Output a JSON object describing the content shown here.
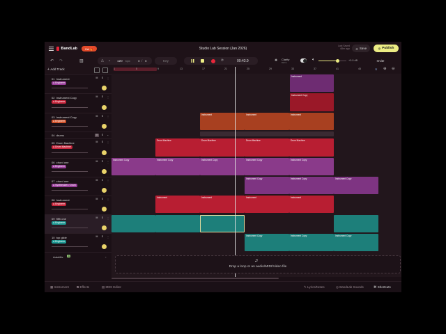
{
  "app": {
    "logo": "BandLab",
    "badge": "Get 🎁",
    "title": "Studio Lab Session (Jan 2026)",
    "last_saved": "Last Saved",
    "last_saved_time": "48m ago",
    "save": "Save",
    "publish": "Publish",
    "invite": "Invite"
  },
  "transport": {
    "tempo": "120",
    "tempo_unit": "bpm",
    "sig_num": "4",
    "sig_den": "4",
    "key": "Key",
    "time": "00:43.9",
    "clarity": "Clarity",
    "clarity_sub": "BETA",
    "volume_db": "+0.0 dB"
  },
  "tracks_header": {
    "add": "Add Track"
  },
  "ruler": [
    "1",
    "5",
    "9",
    "13",
    "17",
    "21",
    "25",
    "29",
    "33",
    "37",
    "41",
    "45"
  ],
  "tracks": [
    {
      "num": "01",
      "name": "Instrument",
      "badge": "● Engineer",
      "badge_color": "#9b3f9c",
      "knob": true
    },
    {
      "num": "02",
      "name": "Instrument Copy",
      "badge": "● Engineer",
      "badge_color": "#c8263c",
      "knob": true
    },
    {
      "num": "03",
      "name": "Instrument Copy",
      "badge": "● Engineer",
      "badge_color": "#d2542c",
      "knob": true
    },
    {
      "num": "04",
      "name": "drums",
      "badge": "",
      "badge_color": "",
      "knob": false
    },
    {
      "num": "05",
      "name": "Drum Machine",
      "badge": "● Drum Machine",
      "badge_color": "#c8263c",
      "knob": true
    },
    {
      "num": "06",
      "name": "chord one",
      "badge": "● Engineer",
      "badge_color": "#9b3f9c",
      "knob": true
    },
    {
      "num": "07",
      "name": "chord one",
      "badge": "● Synthesizer / Drum",
      "badge_color": "#9b3f9c",
      "knob": true
    },
    {
      "num": "08",
      "name": "Instrument",
      "badge": "● Engineer",
      "badge_color": "#c8263c",
      "knob": true
    },
    {
      "num": "09",
      "name": "fifth one",
      "badge": "● Engineer",
      "badge_color": "#1e9a94",
      "knob": true
    },
    {
      "num": "10",
      "name": "top glide",
      "badge": "● Engineer",
      "badge_color": "#1e9a94",
      "knob": true
    }
  ],
  "automix": {
    "label": "AutoMix",
    "ai": "AI"
  },
  "clip_labels": {
    "instrument": "Instrument",
    "instrument_copy": "Instrument Copy",
    "drum_machine": "Drum Machine"
  },
  "dropzone": {
    "text": "Drop a loop or an audio/MIDI/Video file"
  },
  "bottom": {
    "instrument": "Instrument",
    "effects": "Effects",
    "midi": "MIDI Editor",
    "lyrics": "Lyrics/Notes",
    "sounds": "BandLab Sounds",
    "shortcuts": "Shortcuts"
  },
  "colors": {
    "purple": "#8a3a8a",
    "red": "#b81e32",
    "orange": "#c24d24",
    "teal": "#1d7f7a",
    "accent": "#e9e06a",
    "record": "#e8263a"
  },
  "icons": [
    "menu-icon",
    "undo-icon",
    "redo-icon",
    "metronome-icon",
    "chevron-down-icon",
    "pause-icon",
    "stop-icon",
    "record-icon",
    "loop-icon",
    "speaker-icon",
    "magnet-icon",
    "zoom-in-icon",
    "zoom-out-icon",
    "music-note-icon"
  ]
}
